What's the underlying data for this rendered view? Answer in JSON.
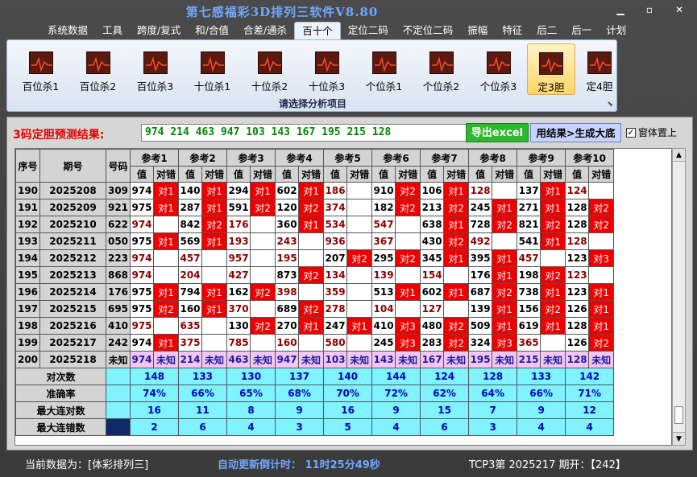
{
  "app": {
    "title": "第七感福彩3D排列三软件V8.80",
    "minimize_symbol": "▁",
    "restore_symbol": "▫",
    "close_symbol": "✕"
  },
  "menu": [
    "系统数据",
    "工具",
    "跨度/复式",
    "和/合值",
    "合差/通杀",
    "百十个",
    "定位二码",
    "不定位二码",
    "振幅",
    "特征",
    "后二",
    "后一",
    "计划"
  ],
  "menu_active_index": 5,
  "ribbon": {
    "buttons": [
      "百位杀1",
      "百位杀2",
      "百位杀3",
      "十位杀1",
      "十位杀2",
      "十位杀3",
      "个位杀1",
      "个位杀2",
      "个位杀3",
      "定3胆",
      "定4胆"
    ],
    "selected_index": 9,
    "caption": "请选择分析项目"
  },
  "prediction": {
    "label": "3码定胆预测结果:",
    "value": "974 214 463 947 103 143 167 195 215 128",
    "export_button": "导出excel",
    "generate_button": "用结果>生成大底",
    "topmost_label": "窗体置上",
    "topmost_checked": "✓"
  },
  "table": {
    "headers": {
      "seq": "序号",
      "period": "期号",
      "number": "号码",
      "value": "值",
      "result": "对错"
    },
    "refs": [
      "参考1",
      "参考2",
      "参考3",
      "参考4",
      "参考5",
      "参考6",
      "参考7",
      "参考8",
      "参考9",
      "参考10"
    ],
    "rows": [
      {
        "seq": "190",
        "period": "2025208",
        "num": "309",
        "cells": [
          [
            "974",
            "对1"
          ],
          [
            "140",
            "对1"
          ],
          [
            "294",
            "对1"
          ],
          [
            "602",
            "对1"
          ],
          [
            "186",
            ""
          ],
          [
            "910",
            "对2"
          ],
          [
            "106",
            "对1"
          ],
          [
            "128",
            ""
          ],
          [
            "137",
            "对1"
          ],
          [
            "124",
            ""
          ]
        ]
      },
      {
        "seq": "191",
        "period": "2025209",
        "num": "921",
        "cells": [
          [
            "975",
            "对1"
          ],
          [
            "287",
            "对1"
          ],
          [
            "591",
            "对2"
          ],
          [
            "120",
            "对2"
          ],
          [
            "374",
            ""
          ],
          [
            "182",
            "对2"
          ],
          [
            "213",
            "对2"
          ],
          [
            "245",
            "对1"
          ],
          [
            "271",
            "对1"
          ],
          [
            "128",
            "对2"
          ]
        ]
      },
      {
        "seq": "192",
        "period": "2025210",
        "num": "622",
        "cells": [
          [
            "974",
            ""
          ],
          [
            "842",
            "对2"
          ],
          [
            "176",
            ""
          ],
          [
            "360",
            "对1"
          ],
          [
            "534",
            ""
          ],
          [
            "547",
            ""
          ],
          [
            "638",
            "对1"
          ],
          [
            "728",
            "对2"
          ],
          [
            "821",
            "对2"
          ],
          [
            "128",
            "对2"
          ]
        ]
      },
      {
        "seq": "193",
        "period": "2025211",
        "num": "050",
        "cells": [
          [
            "975",
            "对1"
          ],
          [
            "569",
            "对1"
          ],
          [
            "193",
            ""
          ],
          [
            "243",
            ""
          ],
          [
            "936",
            ""
          ],
          [
            "367",
            ""
          ],
          [
            "430",
            "对2"
          ],
          [
            "492",
            ""
          ],
          [
            "541",
            "对1"
          ],
          [
            "128",
            ""
          ]
        ]
      },
      {
        "seq": "194",
        "period": "2025212",
        "num": "223",
        "cells": [
          [
            "974",
            ""
          ],
          [
            "457",
            ""
          ],
          [
            "957",
            ""
          ],
          [
            "195",
            ""
          ],
          [
            "207",
            "对2"
          ],
          [
            "295",
            "对2"
          ],
          [
            "345",
            "对1"
          ],
          [
            "395",
            "对1"
          ],
          [
            "457",
            ""
          ],
          [
            "123",
            "对3"
          ]
        ]
      },
      {
        "seq": "195",
        "period": "2025213",
        "num": "868",
        "cells": [
          [
            "974",
            ""
          ],
          [
            "204",
            ""
          ],
          [
            "427",
            ""
          ],
          [
            "873",
            "对2"
          ],
          [
            "134",
            ""
          ],
          [
            "139",
            ""
          ],
          [
            "154",
            ""
          ],
          [
            "176",
            "对1"
          ],
          [
            "198",
            "对2"
          ],
          [
            "123",
            ""
          ]
        ]
      },
      {
        "seq": "196",
        "period": "2025214",
        "num": "176",
        "cells": [
          [
            "975",
            "对1"
          ],
          [
            "794",
            "对1"
          ],
          [
            "162",
            "对2"
          ],
          [
            "398",
            ""
          ],
          [
            "359",
            ""
          ],
          [
            "513",
            "对1"
          ],
          [
            "602",
            "对1"
          ],
          [
            "687",
            "对2"
          ],
          [
            "738",
            "对1"
          ],
          [
            "123",
            "对1"
          ]
        ]
      },
      {
        "seq": "197",
        "period": "2025215",
        "num": "695",
        "cells": [
          [
            "975",
            "对2"
          ],
          [
            "160",
            "对1"
          ],
          [
            "370",
            ""
          ],
          [
            "689",
            "对2"
          ],
          [
            "278",
            ""
          ],
          [
            "104",
            ""
          ],
          [
            "127",
            ""
          ],
          [
            "139",
            "对1"
          ],
          [
            "156",
            "对2"
          ],
          [
            "126",
            "对1"
          ]
        ]
      },
      {
        "seq": "198",
        "period": "2025216",
        "num": "410",
        "cells": [
          [
            "975",
            ""
          ],
          [
            "635",
            ""
          ],
          [
            "130",
            "对2"
          ],
          [
            "270",
            "对1"
          ],
          [
            "247",
            "对1"
          ],
          [
            "410",
            "对3"
          ],
          [
            "480",
            "对2"
          ],
          [
            "509",
            "对1"
          ],
          [
            "619",
            "对1"
          ],
          [
            "128",
            "对1"
          ]
        ]
      },
      {
        "seq": "199",
        "period": "2025217",
        "num": "242",
        "cells": [
          [
            "974",
            "对1"
          ],
          [
            "375",
            ""
          ],
          [
            "785",
            ""
          ],
          [
            "160",
            ""
          ],
          [
            "580",
            ""
          ],
          [
            "245",
            "对3"
          ],
          [
            "283",
            "对2"
          ],
          [
            "324",
            "对3"
          ],
          [
            "365",
            ""
          ],
          [
            "126",
            "对2"
          ]
        ]
      }
    ],
    "prediction_row": {
      "seq": "200",
      "period": "2025218",
      "num": "未知",
      "values": [
        "974",
        "214",
        "463",
        "947",
        "103",
        "143",
        "167",
        "195",
        "215",
        "128"
      ],
      "unknown": "未知"
    },
    "stats": [
      {
        "label": "对次数",
        "values": [
          "148",
          "133",
          "130",
          "137",
          "140",
          "144",
          "124",
          "128",
          "133",
          "142"
        ]
      },
      {
        "label": "准确率",
        "values": [
          "74%",
          "66%",
          "65%",
          "68%",
          "70%",
          "72%",
          "62%",
          "64%",
          "66%",
          "71%"
        ]
      },
      {
        "label": "最大连对数",
        "values": [
          "16",
          "11",
          "8",
          "9",
          "16",
          "9",
          "15",
          "7",
          "9",
          "12"
        ]
      },
      {
        "label": "最大连错数",
        "values": [
          "2",
          "6",
          "4",
          "3",
          "5",
          "4",
          "6",
          "3",
          "4",
          "4"
        ]
      }
    ]
  },
  "status": {
    "current_data": "当前数据为：[体彩排列三]",
    "countdown": "自动更新倒计时： 11时25分49秒",
    "draw": "TCP3第 2025217 期开：【242】"
  }
}
